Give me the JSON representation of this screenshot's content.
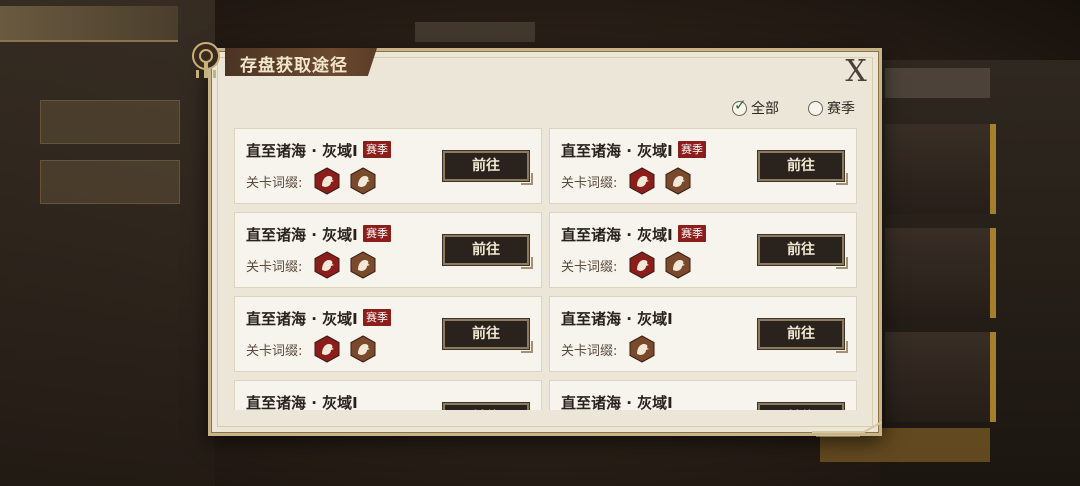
{
  "background": {
    "left_tab": "",
    "side_items": [
      "",
      ""
    ]
  },
  "dialog": {
    "title": "存盘获取途径",
    "close_label": "X",
    "filters": [
      {
        "label": "全部",
        "checked": true
      },
      {
        "label": "赛季",
        "checked": false
      }
    ],
    "affix_label": "关卡词缀:",
    "go_label": "前往",
    "season_label": "赛季",
    "cards": [
      {
        "title": "直至诸海 · 灰域Ⅰ",
        "season": true,
        "affixes": [
          "red-affix-icon",
          "brown-affix-icon"
        ]
      },
      {
        "title": "直至诸海 · 灰域Ⅰ",
        "season": true,
        "affixes": [
          "red-affix-icon",
          "brown-affix-icon"
        ]
      },
      {
        "title": "直至诸海 · 灰域Ⅰ",
        "season": true,
        "affixes": [
          "red-affix-icon",
          "brown-affix-icon"
        ]
      },
      {
        "title": "直至诸海 · 灰域Ⅰ",
        "season": true,
        "affixes": [
          "red-affix-icon",
          "brown-affix-icon"
        ]
      },
      {
        "title": "直至诸海 · 灰域Ⅰ",
        "season": true,
        "affixes": [
          "red-affix-icon",
          "brown-affix-icon"
        ]
      },
      {
        "title": "直至诸海 · 灰域Ⅰ",
        "season": false,
        "affixes": [
          "brown-affix-icon"
        ]
      },
      {
        "title": "直至诸海 · 灰域Ⅰ",
        "season": false,
        "affixes": []
      },
      {
        "title": "直至诸海 · 灰域Ⅰ",
        "season": false,
        "affixes": []
      }
    ]
  },
  "colors": {
    "dialog_bg": "#ece6d8",
    "season_badge": "#8b1e1a",
    "affix_red": "#8b1e1a",
    "affix_brown": "#7a4a2c",
    "button_bg": "#2a231d"
  }
}
